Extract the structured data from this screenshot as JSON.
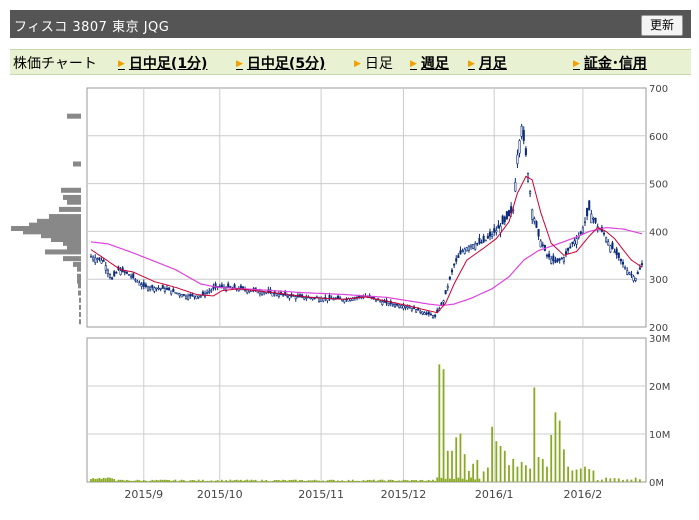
{
  "header": {
    "title": "フィスコ 3807 東京 JQG",
    "refresh_label": "更新"
  },
  "tabs": [
    {
      "label": "株価チャート",
      "link": false,
      "arrow": false
    },
    {
      "label": "日中足(1分)",
      "link": true,
      "arrow": true
    },
    {
      "label": "日中足(5分)",
      "link": true,
      "arrow": true
    },
    {
      "label": "日足",
      "link": false,
      "arrow": true
    },
    {
      "label": "週足",
      "link": true,
      "arrow": true
    },
    {
      "label": "月足",
      "link": true,
      "arrow": true
    },
    {
      "label": "証金･信用",
      "link": true,
      "arrow": true
    }
  ],
  "colors": {
    "up_candle": "#ffffff",
    "down_candle": "#0a2a78",
    "short_ma": "#cc0033",
    "long_ma": "#dd44dd",
    "volume": "#88aa22",
    "price_band": "#888888",
    "grid": "#cccccc"
  },
  "chart_data": {
    "type": "candlestick",
    "x_tick_labels": [
      "2015/9",
      "2015/10",
      "2015/11",
      "2015/12",
      "2016/1",
      "2016/2"
    ],
    "price_axis": {
      "ylim": [
        200,
        700
      ],
      "ticks": [
        200,
        300,
        400,
        500,
        600,
        700
      ]
    },
    "volume_axis": {
      "ylim": [
        0,
        30000000
      ],
      "tick_labels": [
        "0M",
        "10M",
        "20M",
        "30M"
      ]
    },
    "price_anchors": [
      [
        0,
        348
      ],
      [
        6,
        338
      ],
      [
        10,
        300
      ],
      [
        13,
        320
      ],
      [
        18,
        310
      ],
      [
        25,
        285
      ],
      [
        35,
        280
      ],
      [
        45,
        265
      ],
      [
        52,
        265
      ],
      [
        60,
        285
      ],
      [
        70,
        280
      ],
      [
        80,
        275
      ],
      [
        90,
        268
      ],
      [
        100,
        262
      ],
      [
        110,
        260
      ],
      [
        120,
        258
      ],
      [
        130,
        265
      ],
      [
        140,
        250
      ],
      [
        150,
        243
      ],
      [
        158,
        230
      ],
      [
        163,
        222
      ],
      [
        167,
        255
      ],
      [
        172,
        330
      ],
      [
        176,
        360
      ],
      [
        180,
        372
      ],
      [
        186,
        378
      ],
      [
        192,
        402
      ],
      [
        196,
        420
      ],
      [
        200,
        445
      ],
      [
        202,
        560
      ],
      [
        204,
        620
      ],
      [
        206,
        560
      ],
      [
        209,
        445
      ],
      [
        212,
        390
      ],
      [
        216,
        350
      ],
      [
        220,
        335
      ],
      [
        224,
        345
      ],
      [
        228,
        375
      ],
      [
        232,
        395
      ],
      [
        236,
        445
      ],
      [
        240,
        410
      ],
      [
        243,
        395
      ],
      [
        246,
        370
      ],
      [
        250,
        345
      ],
      [
        254,
        318
      ],
      [
        258,
        302
      ],
      [
        261,
        330
      ]
    ],
    "short_ma_anchors": [
      [
        0,
        362
      ],
      [
        8,
        338
      ],
      [
        14,
        320
      ],
      [
        20,
        315
      ],
      [
        30,
        295
      ],
      [
        40,
        283
      ],
      [
        50,
        268
      ],
      [
        58,
        265
      ],
      [
        62,
        276
      ],
      [
        70,
        280
      ],
      [
        80,
        275
      ],
      [
        90,
        270
      ],
      [
        100,
        264
      ],
      [
        110,
        260
      ],
      [
        120,
        258
      ],
      [
        130,
        263
      ],
      [
        140,
        254
      ],
      [
        150,
        245
      ],
      [
        158,
        236
      ],
      [
        164,
        230
      ],
      [
        168,
        250
      ],
      [
        172,
        290
      ],
      [
        178,
        340
      ],
      [
        186,
        365
      ],
      [
        192,
        385
      ],
      [
        198,
        420
      ],
      [
        202,
        480
      ],
      [
        206,
        515
      ],
      [
        209,
        508
      ],
      [
        213,
        440
      ],
      [
        218,
        375
      ],
      [
        224,
        350
      ],
      [
        230,
        358
      ],
      [
        236,
        390
      ],
      [
        240,
        408
      ],
      [
        244,
        400
      ],
      [
        248,
        385
      ],
      [
        252,
        362
      ],
      [
        256,
        340
      ],
      [
        261,
        325
      ]
    ],
    "long_ma_anchors": [
      [
        0,
        378
      ],
      [
        8,
        374
      ],
      [
        20,
        355
      ],
      [
        40,
        320
      ],
      [
        52,
        290
      ],
      [
        60,
        283
      ],
      [
        80,
        278
      ],
      [
        100,
        272
      ],
      [
        120,
        268
      ],
      [
        140,
        262
      ],
      [
        150,
        255
      ],
      [
        160,
        248
      ],
      [
        166,
        245
      ],
      [
        172,
        248
      ],
      [
        180,
        260
      ],
      [
        190,
        280
      ],
      [
        198,
        305
      ],
      [
        205,
        340
      ],
      [
        212,
        360
      ],
      [
        220,
        372
      ],
      [
        228,
        385
      ],
      [
        236,
        400
      ],
      [
        244,
        408
      ],
      [
        252,
        405
      ],
      [
        261,
        395
      ]
    ],
    "volume_events_millions": [
      [
        165,
        24.5
      ],
      [
        167,
        23.5
      ],
      [
        169,
        6.5
      ],
      [
        171,
        6.5
      ],
      [
        173,
        9.3
      ],
      [
        175,
        10.1
      ],
      [
        177,
        5.8
      ],
      [
        179,
        2.3
      ],
      [
        181,
        3.8
      ],
      [
        183,
        4.6
      ],
      [
        186,
        2.2
      ],
      [
        188,
        3
      ],
      [
        190,
        11.5
      ],
      [
        192,
        8.5
      ],
      [
        194,
        7.5
      ],
      [
        196,
        6.5
      ],
      [
        198,
        3.5
      ],
      [
        200,
        4.8
      ],
      [
        202,
        3.2
      ],
      [
        204,
        4.2
      ],
      [
        206,
        3.5
      ],
      [
        208,
        2.8
      ],
      [
        210,
        19.7
      ],
      [
        212,
        5.2
      ],
      [
        214,
        4.8
      ],
      [
        216,
        3.2
      ],
      [
        218,
        9.8
      ],
      [
        220,
        14.5
      ],
      [
        222,
        12.8
      ],
      [
        224,
        6.8
      ],
      [
        226,
        3.2
      ],
      [
        228,
        2.4
      ],
      [
        230,
        2.6
      ],
      [
        232,
        2.8
      ],
      [
        234,
        3.2
      ],
      [
        236,
        2.7
      ],
      [
        238,
        2.4
      ]
    ],
    "price_band_histogram": [
      [
        640,
        14
      ],
      [
        540,
        8
      ],
      [
        485,
        20
      ],
      [
        470,
        18
      ],
      [
        460,
        14
      ],
      [
        445,
        22
      ],
      [
        430,
        32
      ],
      [
        420,
        44
      ],
      [
        412,
        52
      ],
      [
        405,
        70
      ],
      [
        398,
        58
      ],
      [
        390,
        40
      ],
      [
        382,
        30
      ],
      [
        374,
        18
      ],
      [
        366,
        14
      ],
      [
        356,
        36
      ],
      [
        342,
        18
      ],
      [
        330,
        8
      ],
      [
        320,
        4
      ],
      [
        305,
        4
      ],
      [
        295,
        4
      ],
      [
        285,
        3
      ],
      [
        270,
        3
      ],
      [
        255,
        2
      ],
      [
        240,
        2
      ],
      [
        225,
        2
      ],
      [
        210,
        2
      ]
    ]
  }
}
